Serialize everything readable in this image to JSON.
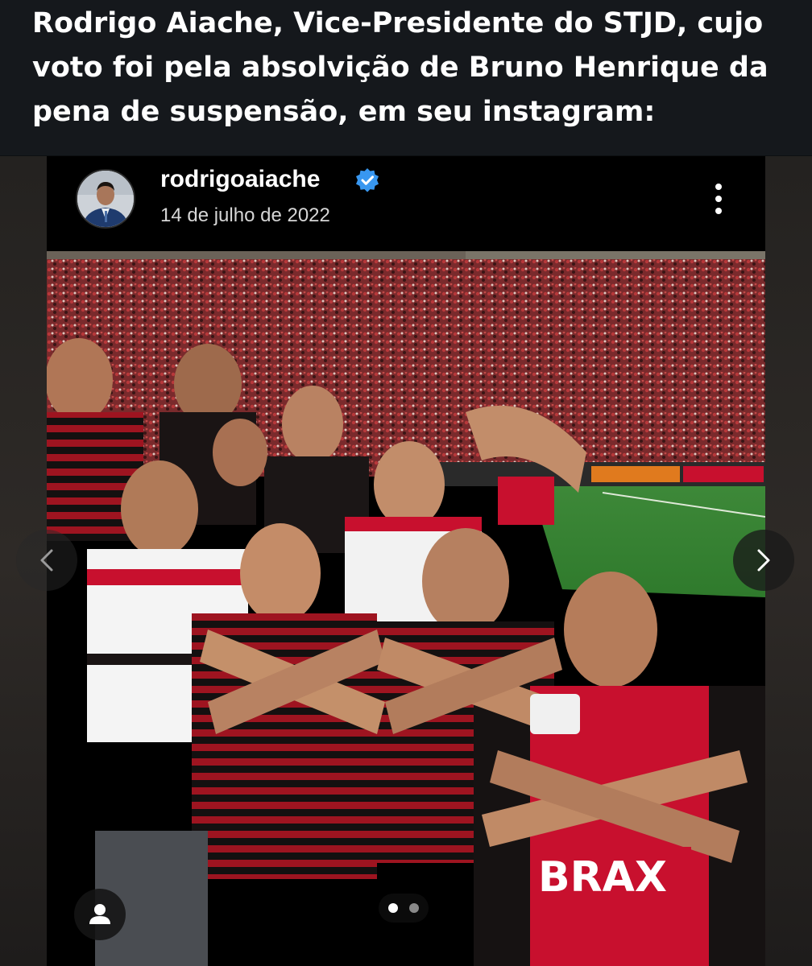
{
  "caption": {
    "text": "Rodrigo Aiache, Vice-Presidente do STJD, cujo voto foi pela absolvição de Bruno Henrique da pena de suspensão, em seu instagram:"
  },
  "post": {
    "username": "rodrigoaiache",
    "verified": true,
    "date": "14 de julho de 2022",
    "carousel": {
      "current": 1,
      "total": 2
    }
  },
  "icons": {
    "verified": "verified-badge-icon",
    "more": "more-options-icon",
    "prev": "chevron-left-icon",
    "next": "chevron-right-icon",
    "user_tag": "user-tag-icon"
  },
  "colors": {
    "verified_blue": "#3897f0",
    "flamengo_red": "#c8102e",
    "background": "#0d0f12"
  }
}
